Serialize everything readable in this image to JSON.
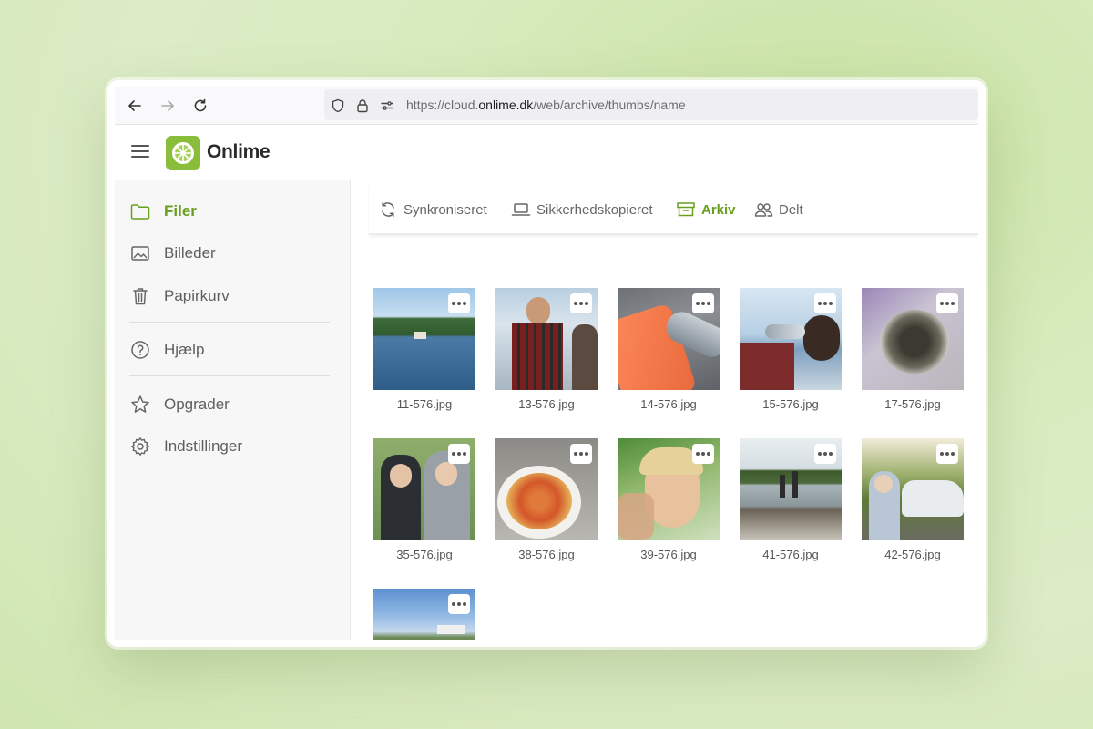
{
  "browser": {
    "url_prefix": "https://cloud.",
    "url_domain": "onlime.dk",
    "url_path": "/web/archive/thumbs/name"
  },
  "app": {
    "name": "Onlime"
  },
  "sidebar": {
    "items": [
      {
        "label": "Filer",
        "icon": "folder-icon",
        "active": true
      },
      {
        "label": "Billeder",
        "icon": "image-icon",
        "active": false
      },
      {
        "label": "Papirkurv",
        "icon": "trash-icon",
        "active": false
      },
      {
        "label": "Hjælp",
        "icon": "help-icon",
        "active": false
      },
      {
        "label": "Opgrader",
        "icon": "star-icon",
        "active": false
      },
      {
        "label": "Indstillinger",
        "icon": "gear-icon",
        "active": false
      }
    ]
  },
  "tabs": [
    {
      "label": "Synkroniseret",
      "icon": "sync-icon",
      "active": false
    },
    {
      "label": "Sikkerhedskopieret",
      "icon": "laptop-icon",
      "active": false
    },
    {
      "label": "Arkiv",
      "icon": "archive-icon",
      "active": true
    },
    {
      "label": "Delt",
      "icon": "users-icon",
      "active": false
    }
  ],
  "files": [
    {
      "name": "11-576.jpg"
    },
    {
      "name": "13-576.jpg"
    },
    {
      "name": "14-576.jpg"
    },
    {
      "name": "15-576.jpg"
    },
    {
      "name": "17-576.jpg"
    },
    {
      "name": "35-576.jpg"
    },
    {
      "name": "38-576.jpg"
    },
    {
      "name": "39-576.jpg"
    },
    {
      "name": "41-576.jpg"
    },
    {
      "name": "42-576.jpg"
    },
    {
      "name": ""
    }
  ],
  "colors": {
    "accent": "#6a9e1f",
    "logo": "#8bbd3c"
  }
}
